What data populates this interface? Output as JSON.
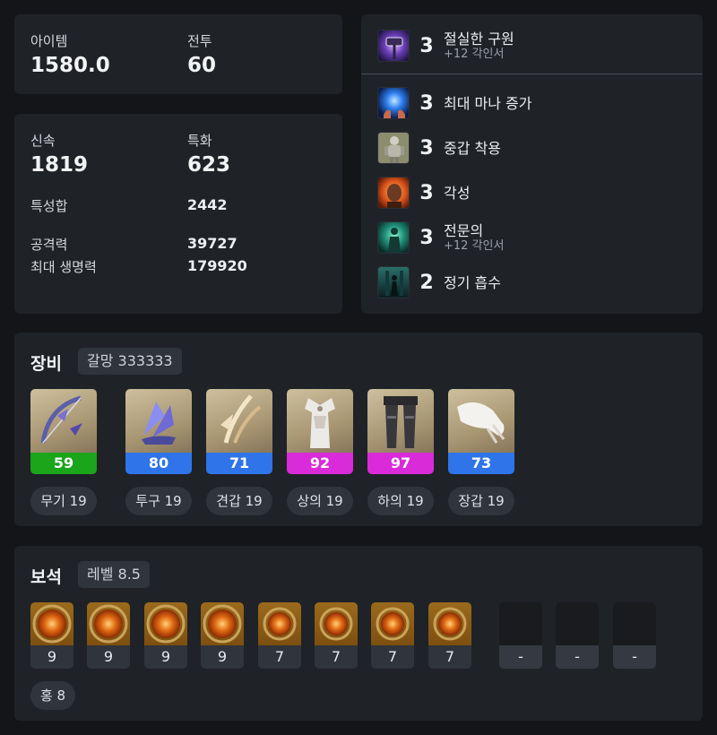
{
  "summary": {
    "item_level_label": "아이템",
    "item_level_value": "1580.0",
    "combat_label": "전투",
    "combat_value": "60"
  },
  "stats": {
    "swiftness_label": "신속",
    "swiftness_value": "1819",
    "specialization_label": "특화",
    "specialization_value": "623",
    "total_label": "특성합",
    "total_value": "2442",
    "attack_label": "공격력",
    "attack_value": "39727",
    "hp_label": "최대 생명력",
    "hp_value": "179920"
  },
  "engravings": [
    {
      "level": "3",
      "name": "절실한 구원",
      "sub": "+12 각인서",
      "icon": "grudge-hammer-icon"
    },
    {
      "level": "3",
      "name": "최대 마나 증가",
      "sub": "",
      "icon": "mana-orb-icon"
    },
    {
      "level": "3",
      "name": "중갑 착용",
      "sub": "",
      "icon": "heavy-armor-icon"
    },
    {
      "level": "3",
      "name": "각성",
      "sub": "",
      "icon": "awakening-icon"
    },
    {
      "level": "3",
      "name": "전문의",
      "sub": "+12 각인서",
      "icon": "expert-icon"
    },
    {
      "level": "2",
      "name": "정기 흡수",
      "sub": "",
      "icon": "spirit-absorption-icon"
    }
  ],
  "equipment": {
    "title": "장비",
    "chip": "갈망 333333",
    "items": [
      {
        "quality": "59",
        "tag": "무기 19",
        "color": "#1aa51a",
        "icon": "bow-icon"
      },
      {
        "quality": "80",
        "tag": "투구 19",
        "color": "#2f74e8",
        "icon": "helmet-icon"
      },
      {
        "quality": "71",
        "tag": "견갑 19",
        "color": "#2f74e8",
        "icon": "shoulder-icon"
      },
      {
        "quality": "92",
        "tag": "상의 19",
        "color": "#d92bd9",
        "icon": "chest-armor-icon"
      },
      {
        "quality": "97",
        "tag": "하의 19",
        "color": "#d92bd9",
        "icon": "pants-icon"
      },
      {
        "quality": "73",
        "tag": "장갑 19",
        "color": "#2f74e8",
        "icon": "gloves-icon"
      }
    ]
  },
  "gems": {
    "title": "보석",
    "chip": "레벨 8.5",
    "items": [
      {
        "level": "9",
        "icon": "gem-icon"
      },
      {
        "level": "9",
        "icon": "gem-icon"
      },
      {
        "level": "9",
        "icon": "gem-icon"
      },
      {
        "level": "9",
        "icon": "gem-icon"
      },
      {
        "level": "7",
        "icon": "gem-icon"
      },
      {
        "level": "7",
        "icon": "gem-icon"
      },
      {
        "level": "7",
        "icon": "gem-icon"
      },
      {
        "level": "7",
        "icon": "gem-icon"
      },
      {
        "level": "-",
        "icon": "empty-gem-slot-icon"
      },
      {
        "level": "-",
        "icon": "empty-gem-slot-icon"
      },
      {
        "level": "-",
        "icon": "empty-gem-slot-icon"
      }
    ],
    "summary_tag": "홍 8"
  }
}
